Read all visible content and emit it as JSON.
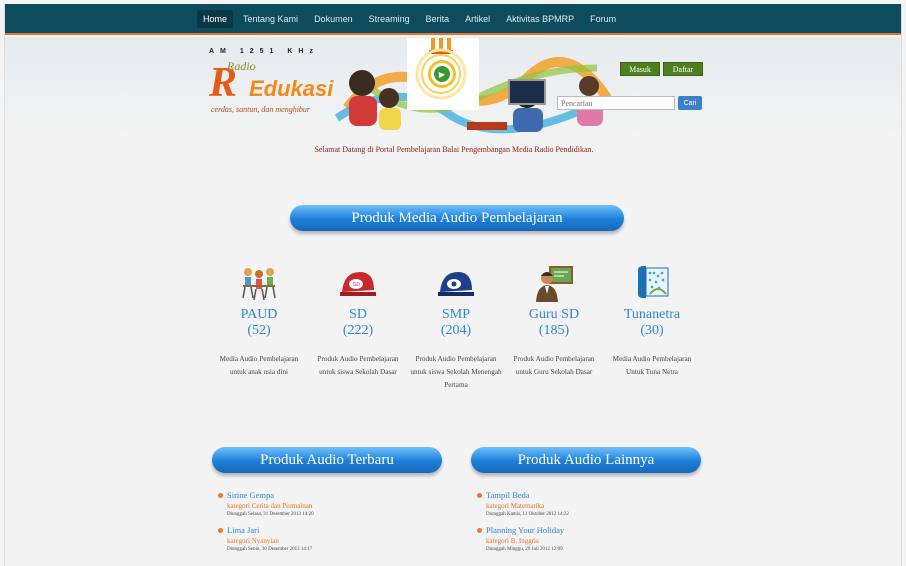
{
  "nav": {
    "items": [
      "Home",
      "Tentang Kami",
      "Dokumen",
      "Streaming",
      "Berita",
      "Artikel",
      "Aktivitas BPMRP",
      "Forum"
    ]
  },
  "logo": {
    "frequency": "AM 1251 KHz",
    "radio": "Radio",
    "name": "Edukasi",
    "tagline": "cerdas, santun, dan menghibur"
  },
  "header": {
    "login_label": "Masuk",
    "register_label": "Daftar",
    "search_placeholder": "Pencarian",
    "search_button": "Cari"
  },
  "welcome": "Selamat Datang di Portal Pembelajaran Balai Pengembangan Media Radio Pendidikan.",
  "products_banner": "Produk Media Audio Pembelajaran",
  "categories": [
    {
      "name": "PAUD",
      "count": "(52)",
      "desc": "Media Audio Pembelajaran untuk anak usia dini",
      "icon": "children-icon"
    },
    {
      "name": "SD",
      "count": "(222)",
      "desc": "Produk Audio Pembelajaran untuk siswa Sekolah Dasar",
      "icon": "red-cap-icon"
    },
    {
      "name": "SMP",
      "count": "(204)",
      "desc": "Produk Audio Pembelajaran untuk siswa Sekolah Menengah Pertama",
      "icon": "blue-cap-icon"
    },
    {
      "name": "Guru SD",
      "count": "(185)",
      "desc": "Produk Audio Pembelajaran untuk Guru Sekolah Dasar",
      "icon": "teacher-icon"
    },
    {
      "name": "Tunanetra",
      "count": "(30)",
      "desc": "Media Audio Pembelajaran Untuk Tuna Netra",
      "icon": "braille-book-icon"
    }
  ],
  "latest": {
    "banner": "Produk Audio Terbaru",
    "items": [
      {
        "title": "Sirine Gempa",
        "kategori_label": "kategori",
        "kategori": "Cerita dan Permainan",
        "date": "Diunggah Selasa, 31 Desember 2013 14:20"
      },
      {
        "title": "Lima Jari",
        "kategori_label": "kategori",
        "kategori": "Nyanyian",
        "date": "Diunggah Senin, 30 Desember 2013 14:17"
      }
    ]
  },
  "others": {
    "banner": "Produk Audio Lainnya",
    "items": [
      {
        "title": "Tampil Beda",
        "kategori_label": "kategori",
        "kategori": "Matematika",
        "date": "Diunggah Kamis, 11 Oktober 2012 14:22"
      },
      {
        "title": "Planning Your Holiday",
        "kategori_label": "kategori",
        "kategori": "B. Inggris",
        "date": "Diunggah Minggu, 29 Juli 2012 12:09"
      }
    ]
  },
  "colors": {
    "nav_bg": "#0d4c5e",
    "accent_orange": "#e8732a",
    "link_blue": "#2e86d6",
    "banner_blue": "#1d7fd8",
    "button_green": "#4f7f1f"
  }
}
